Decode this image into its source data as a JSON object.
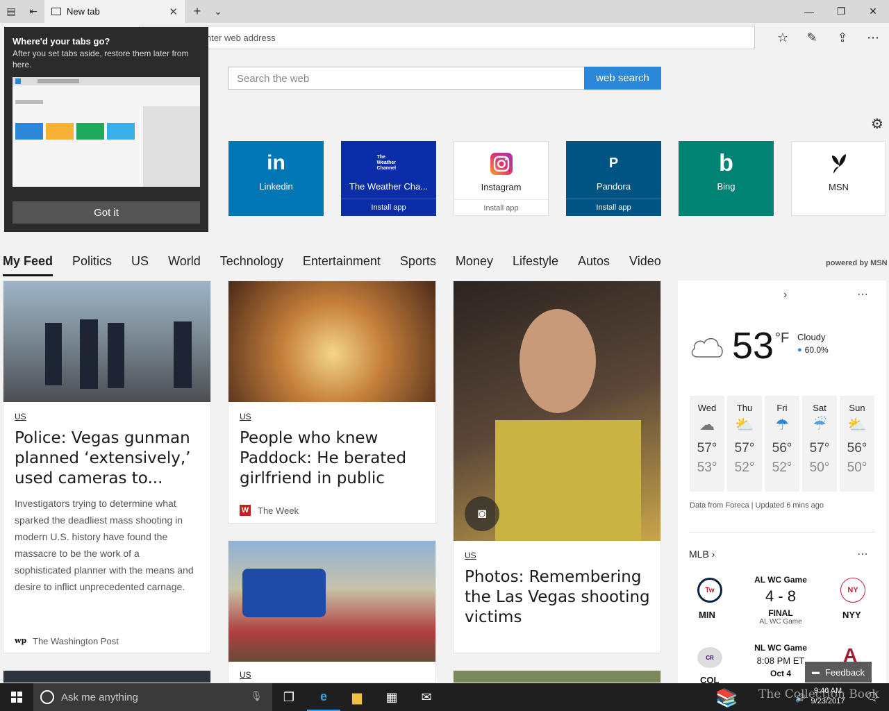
{
  "browser": {
    "tab_title": "New tab",
    "address_placeholder": "nter web address"
  },
  "search": {
    "placeholder": "Search the web",
    "button_label": "web search"
  },
  "tiles": [
    {
      "name": "Linkedin",
      "icon": "in",
      "install": "",
      "color": "#0077b5"
    },
    {
      "name": "The Weather Cha...",
      "icon": "The Weather Channel",
      "install": "Install app",
      "color": "#0b2ea8"
    },
    {
      "name": "Instagram",
      "icon": "instagram-icon",
      "install": "Install app",
      "color": "#ffffff"
    },
    {
      "name": "Pandora",
      "icon": "P",
      "install": "Install app",
      "color": "#005483"
    },
    {
      "name": "Bing",
      "icon": "b",
      "install": "",
      "color": "#008373"
    },
    {
      "name": "MSN",
      "icon": "msn-butterfly-icon",
      "install": "",
      "color": "#ffffff"
    }
  ],
  "feed_nav": [
    "My Feed",
    "Politics",
    "US",
    "World",
    "Technology",
    "Entertainment",
    "Sports",
    "Money",
    "Lifestyle",
    "Autos",
    "Video"
  ],
  "powered_by": "powered by MSN",
  "cards": {
    "c1": {
      "category": "US",
      "headline": "Police: Vegas gunman planned ‘extensively,’ used cameras to...",
      "summary": "Investigators trying to determine what sparked the deadliest mass shooting in modern U.S. history have found the massacre to be the work of a sophisticated planner with the means and desire to inflict unprecedented carnage.",
      "source": "The Washington Post",
      "source_icon": "wp"
    },
    "c2": {
      "category": "US",
      "headline": "People who knew Paddock: He berated girlfriend in public",
      "source": "The Week",
      "source_icon": "W"
    },
    "c3": {
      "category": "US",
      "headline": "Photos: Remembering the Las Vegas shooting victims"
    },
    "c4": {
      "category": "US"
    }
  },
  "weather": {
    "temp": "53",
    "unit": "°F",
    "condition": "Cloudy",
    "precip": "60.0%",
    "days": [
      {
        "day": "Wed",
        "hi": "57°",
        "lo": "53°",
        "icon": "cloud-icon"
      },
      {
        "day": "Thu",
        "hi": "57°",
        "lo": "52°",
        "icon": "partly-sunny-icon"
      },
      {
        "day": "Fri",
        "hi": "56°",
        "lo": "52°",
        "icon": "rain-icon"
      },
      {
        "day": "Sat",
        "hi": "57°",
        "lo": "50°",
        "icon": "showers-icon"
      },
      {
        "day": "Sun",
        "hi": "56°",
        "lo": "50°",
        "icon": "partly-sunny-icon"
      }
    ],
    "footer": "Data from Foreca | Updated 6 mins ago"
  },
  "mlb": {
    "title": "MLB",
    "game1": {
      "label": "AL WC Game",
      "score": "4 - 8",
      "status": "FINAL",
      "sub": "AL WC Game",
      "home": "MIN",
      "away": "NYY"
    },
    "game2": {
      "label": "NL WC Game",
      "time": "8:08 PM ET",
      "date": "Oct 4",
      "home": "COL"
    }
  },
  "popup": {
    "title": "Where'd your tabs go?",
    "body": "After you set tabs aside, restore them later from here.",
    "button": "Got it"
  },
  "feedback": "Feedback",
  "taskbar": {
    "search_placeholder": "Ask me anything",
    "time": "9:46 AM",
    "date": "9/23/2017"
  },
  "watermark": "The Collection Book"
}
